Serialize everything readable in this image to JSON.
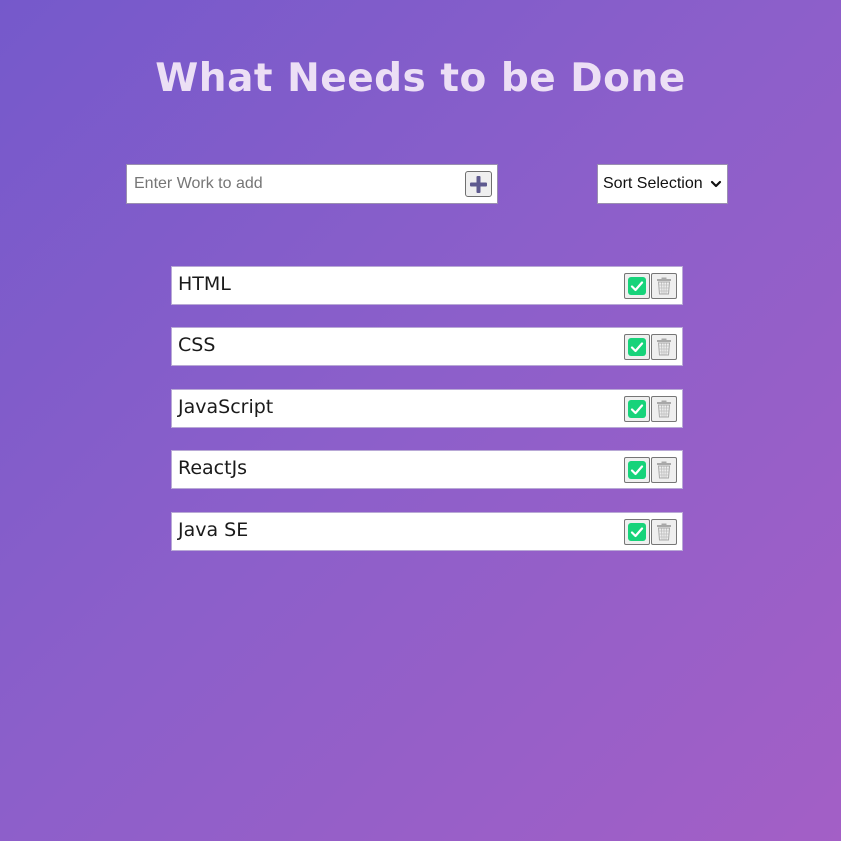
{
  "header": {
    "title": "What Needs to be Done"
  },
  "add_form": {
    "input_placeholder": "Enter Work to add",
    "input_value": "",
    "add_button_icon": "plus-icon"
  },
  "sort": {
    "selected_label": "Sort Selection",
    "icon": "chevron-down-icon"
  },
  "todos": [
    {
      "text": "HTML"
    },
    {
      "text": "CSS"
    },
    {
      "text": "JavaScript"
    },
    {
      "text": "ReactJs"
    },
    {
      "text": "Java SE"
    }
  ],
  "item_actions": {
    "complete_icon": "check-icon",
    "delete_icon": "trash-icon"
  },
  "colors": {
    "background_start": "#7559cb",
    "background_end": "#a35fc6",
    "title": "#ecdff5",
    "check_green": "#17d37a",
    "add_plus": "#5e5a8f"
  }
}
